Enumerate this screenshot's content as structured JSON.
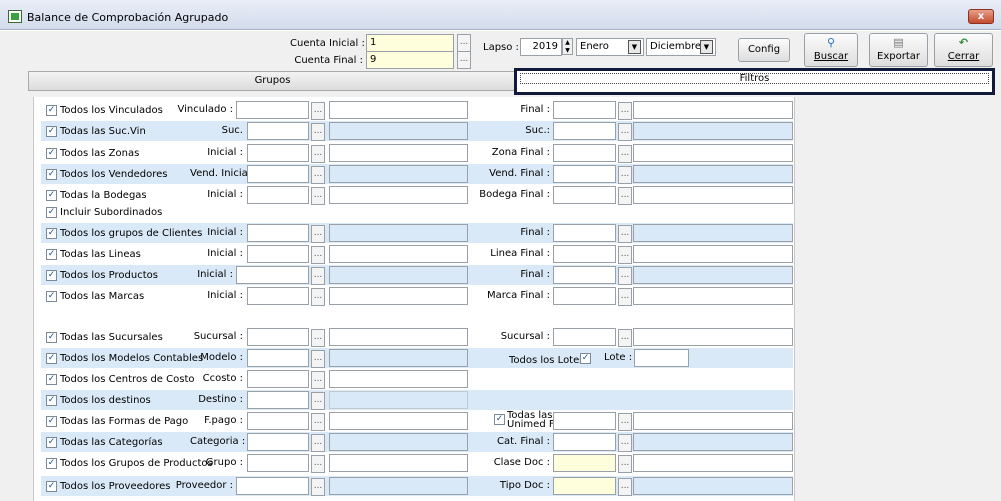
{
  "window": {
    "title": "Balance de Comprobación Agrupado",
    "close": "x"
  },
  "header": {
    "cuenta_inicial_label": "Cuenta Inicial :",
    "cuenta_inicial": "1",
    "cuenta_final_label": "Cuenta Final :",
    "cuenta_final": "9",
    "lapso_label": "Lapso :",
    "year": "2019",
    "mes_inicial": "Enero",
    "mes_final": "Diciembre"
  },
  "toolbar": {
    "config": "Config",
    "buscar": "Buscar",
    "exportar": "Exportar",
    "cerrar": "Cerrar"
  },
  "tabs": {
    "grupos": "Grupos",
    "filtros": "Filtros"
  },
  "icons": {
    "dots": "...",
    "arrow": "▼",
    "up": "▲",
    "check": "✓"
  },
  "rows": [
    {
      "check": "Todos los Vinculados",
      "l1": "Vinculado :",
      "l2": "Final :"
    },
    {
      "check": "Todas las Suc.Vin",
      "l1": "Suc.",
      "l2": "Suc.:"
    },
    {
      "check": "Todos las Zonas",
      "l1": "Inicial :",
      "l2": "Zona Final :"
    },
    {
      "check": "Todos los Vendedores",
      "l1": "Vend. Inicial :",
      "l2": "Vend. Final :"
    },
    {
      "check": "Todas la Bodegas",
      "l1": "Inicial :",
      "l2": "Bodega Final :",
      "extra": "Incluir Subordinados"
    },
    {
      "check": "Todos los grupos de Clientes",
      "l1": "Inicial :",
      "l2": "Final :"
    },
    {
      "check": "Todas las Lineas",
      "l1": "Inicial :",
      "l2": "Linea Final :"
    },
    {
      "check": "Todos los Productos",
      "l1": "Inicial :",
      "l2": "Final :"
    },
    {
      "check": "Todos las Marcas",
      "l1": "Inicial :",
      "l2": "Marca Final :"
    },
    {
      "check": "Todas las Sucursales",
      "l1": "Sucursal :",
      "l2": "Sucursal :"
    },
    {
      "check": "Todos los Modelos Contables",
      "l1": "Modelo :",
      "l2": "Todos los Lotes",
      "l3": "Lote :"
    },
    {
      "check": "Todos los Centros de Costo",
      "l1": "Ccosto :"
    },
    {
      "check": "Todos los destinos",
      "l1": "Destino :"
    },
    {
      "check": "Todas las Formas de Pago",
      "l1": "F.pago :",
      "l2a": "Todas las",
      "l2b": "Unimed FT"
    },
    {
      "check": "Todas las Categorías",
      "l1": "Categoria :",
      "l2": "Cat. Final :"
    },
    {
      "check": "Todos los Grupos de Productos",
      "l1": "Grupo :",
      "l2": "Clase Doc :"
    },
    {
      "check": "Todos los Proveedores",
      "l1": "Proveedor :",
      "l2": "Tipo Doc :"
    }
  ],
  "colors": {
    "row_blue": "#d9e9f7",
    "yellow_input": "#fffedc",
    "highlight_border": "#111a3a"
  }
}
